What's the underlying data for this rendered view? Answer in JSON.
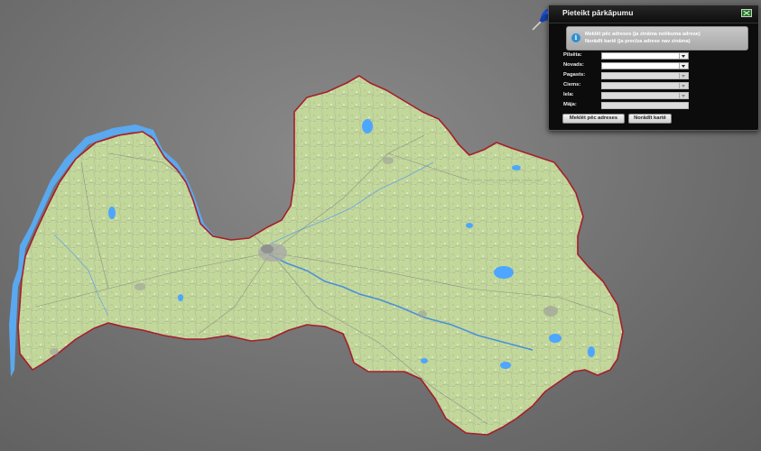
{
  "map": {
    "description_color_land": "#c6d9a0",
    "border_color": "#a51e2d",
    "water_color": "#4da6ff"
  },
  "panel": {
    "title": "Pieteikt pārkāpumu",
    "info": {
      "line1": "Meklēt pēc adreses (ja zināma notikuma adrese)",
      "line2": "Norādīt kartē (ja precīza adrese nav zināma)"
    },
    "fields": [
      {
        "label": "Pilsēta:",
        "type": "select",
        "enabled": true
      },
      {
        "label": "Novads:",
        "type": "select",
        "enabled": true
      },
      {
        "label": "Pagasts:",
        "type": "select",
        "enabled": false
      },
      {
        "label": "Ciems:",
        "type": "select",
        "enabled": false
      },
      {
        "label": "Iela:",
        "type": "select",
        "enabled": false
      },
      {
        "label": "Māja:",
        "type": "input",
        "enabled": false
      }
    ],
    "buttons": {
      "search": "Meklēt pēc adreses",
      "map": "Norādīt kartē"
    }
  },
  "icons": {
    "pin": "pushpin-icon",
    "close": "close-icon",
    "info": "info-icon"
  }
}
